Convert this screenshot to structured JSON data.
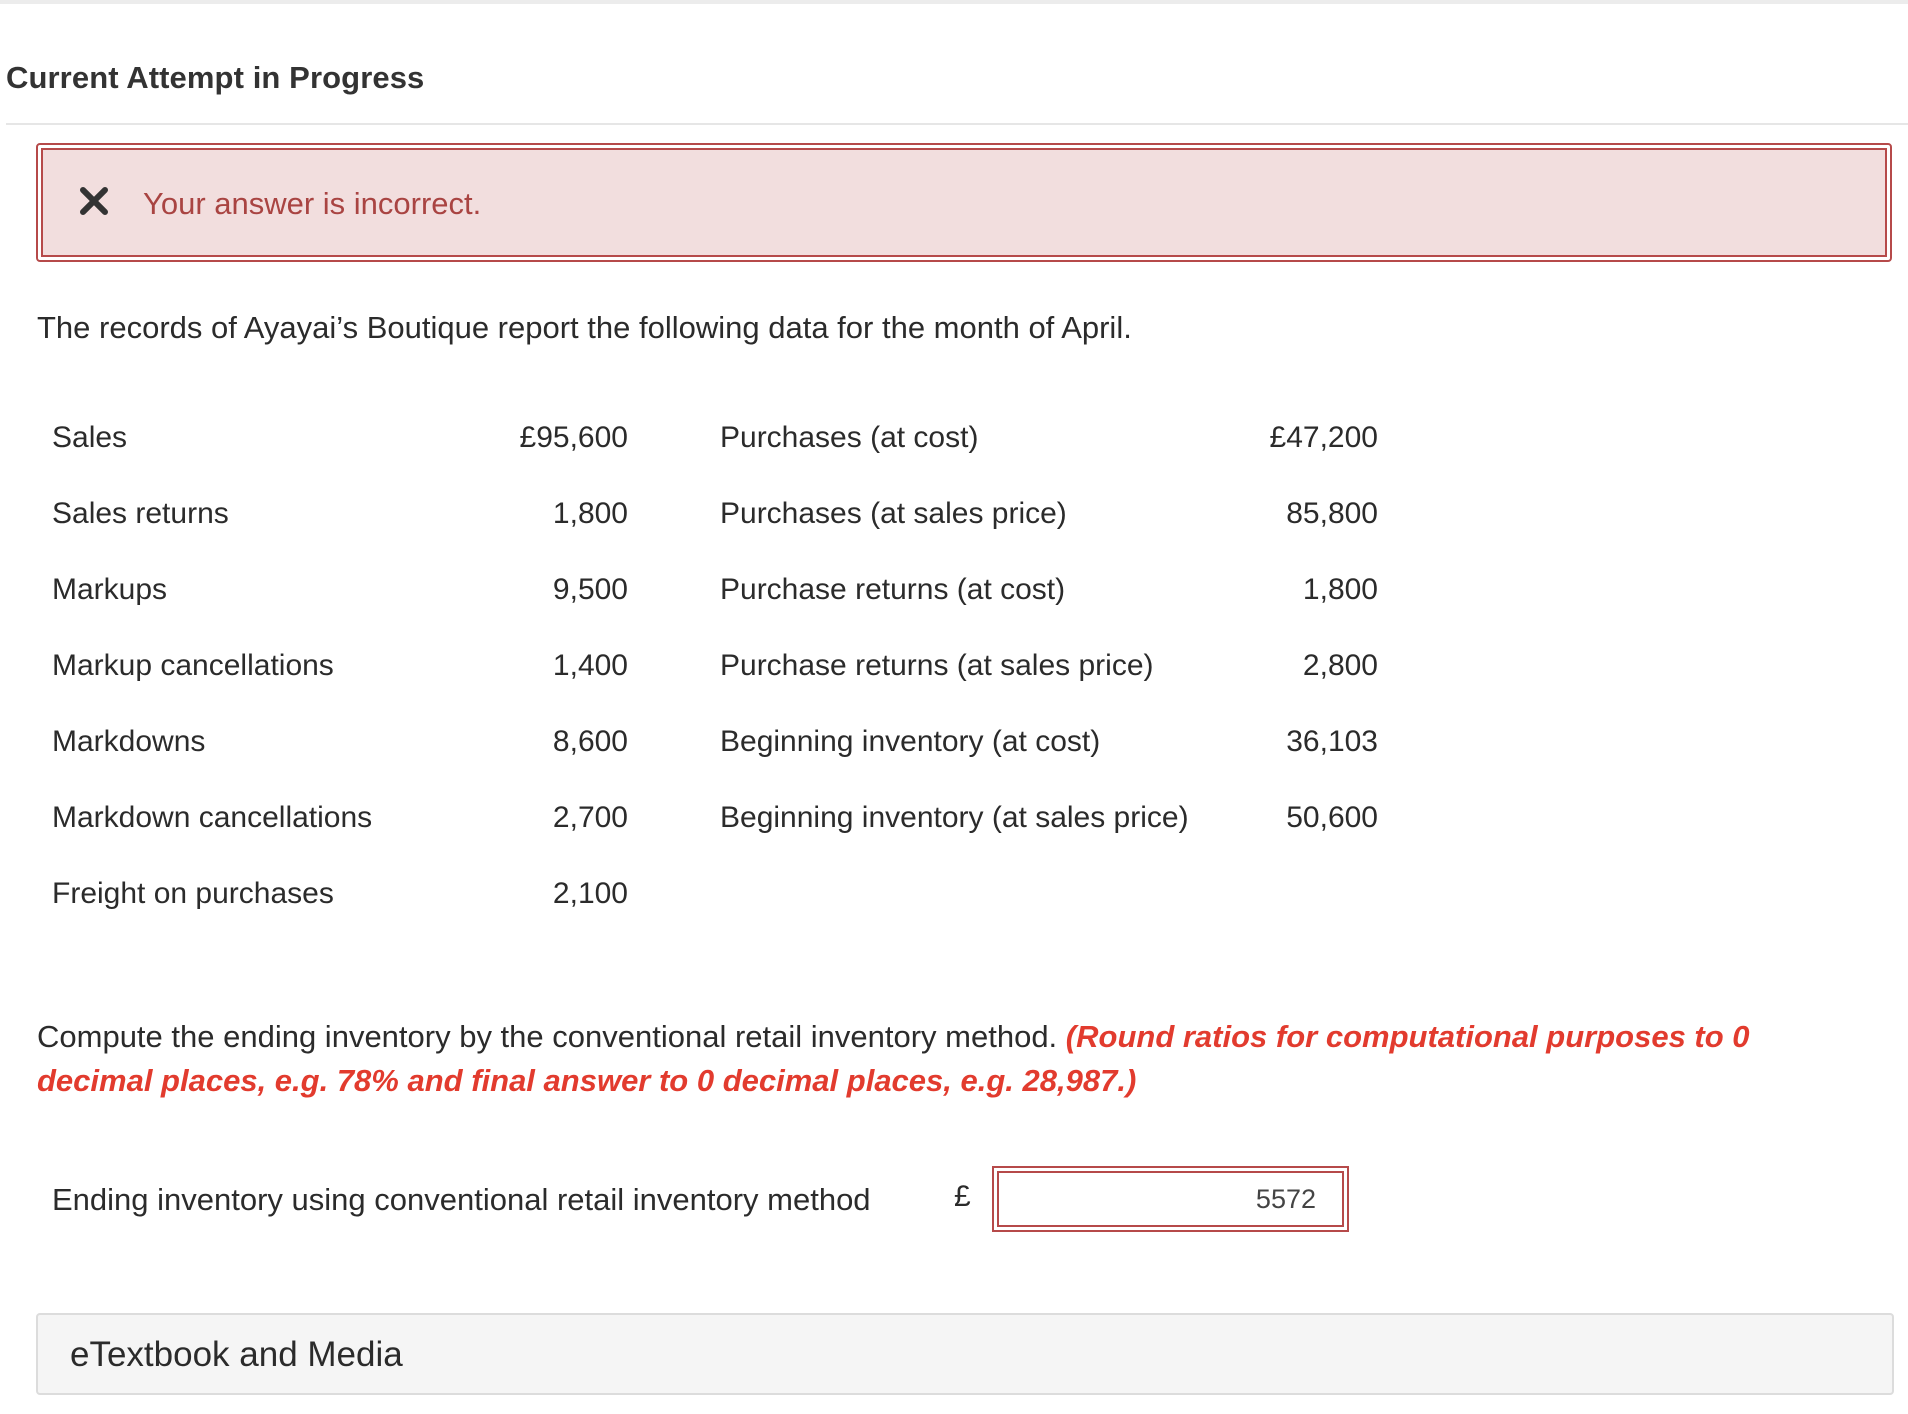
{
  "header": {
    "title": "Current Attempt in Progress"
  },
  "alert": {
    "icon": "close-x-icon",
    "message": "Your answer is incorrect.",
    "color": "#a94442",
    "background": "#f2dede"
  },
  "intro": "The records of Ayayai’s Boutique report the following data for the month of April.",
  "table": {
    "rows": [
      {
        "label1": "Sales",
        "value1": "£95,600",
        "label2": "Purchases (at cost)",
        "value2": "£47,200"
      },
      {
        "label1": "Sales returns",
        "value1": "1,800",
        "label2": "Purchases (at sales price)",
        "value2": "85,800"
      },
      {
        "label1": "Markups",
        "value1": "9,500",
        "label2": "Purchase returns (at cost)",
        "value2": "1,800"
      },
      {
        "label1": "Markup cancellations",
        "value1": "1,400",
        "label2": "Purchase returns (at sales price)",
        "value2": "2,800"
      },
      {
        "label1": "Markdowns",
        "value1": "8,600",
        "label2": "Beginning inventory (at cost)",
        "value2": "36,103"
      },
      {
        "label1": "Markdown cancellations",
        "value1": "2,700",
        "label2": "Beginning inventory (at sales price)",
        "value2": "50,600"
      },
      {
        "label1": "Freight on purchases",
        "value1": "2,100",
        "label2": "",
        "value2": ""
      }
    ]
  },
  "question": {
    "text": "Compute the ending inventory by the conventional retail inventory method.",
    "hint": "(Round ratios for computational purposes to 0 decimal places, e.g. 78% and final answer to 0 decimal places, e.g. 28,987.)",
    "hint_color": "#e23b2e"
  },
  "answer": {
    "label": "Ending inventory using conventional retail inventory method",
    "currency": "£",
    "value": "5572"
  },
  "etextbook": {
    "label": "eTextbook and Media"
  }
}
